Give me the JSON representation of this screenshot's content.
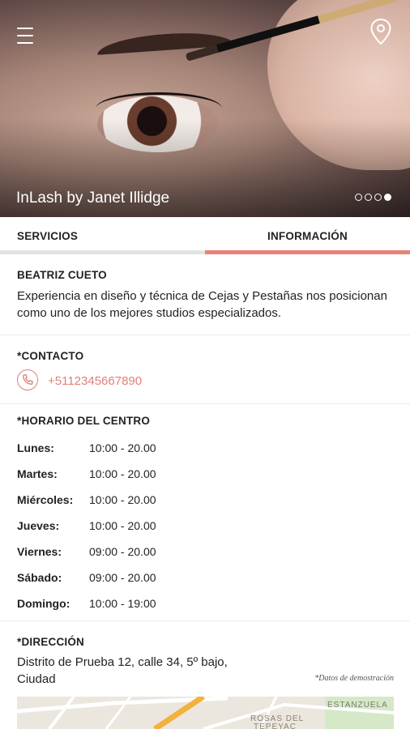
{
  "header": {
    "business_name": "InLash by Janet Illidge",
    "menu_icon": "hamburger-menu-icon",
    "location_icon": "map-pin-icon",
    "carousel_dots": 4,
    "carousel_active_index": 3
  },
  "tabs": [
    {
      "label": "SERVICIOS",
      "active": false
    },
    {
      "label": "INFORMACIÓN",
      "active": true
    }
  ],
  "about": {
    "name": "BEATRIZ CUETO",
    "description": "Experiencia en diseño y técnica de Cejas y Pestañas nos posicionan como uno de los mejores studios especializados."
  },
  "contact": {
    "title": "*CONTACTO",
    "phone_icon": "phone-icon",
    "phone": "+5112345667890"
  },
  "hours": {
    "title": "*HORARIO DEL CENTRO",
    "rows": [
      {
        "day": "Lunes:",
        "time": "10:00 - 20.00"
      },
      {
        "day": "Martes:",
        "time": "10:00 - 20.00"
      },
      {
        "day": "Miércoles:",
        "time": "10:00 - 20.00"
      },
      {
        "day": "Jueves:",
        "time": "10:00 - 20.00"
      },
      {
        "day": "Viernes:",
        "time": "09:00 - 20.00"
      },
      {
        "day": "Sábado:",
        "time": "09:00 - 20.00"
      },
      {
        "day": "Domingo:",
        "time": "10:00 - 19:00"
      }
    ]
  },
  "address": {
    "title": "*DIRECCIÓN",
    "line1": "Distrito de Prueba 12, calle 34, 5º bajo,",
    "line2": "Ciudad",
    "demo_note": "*Datos de demostración"
  },
  "map": {
    "labels": [
      "ROSAS DEL",
      "TEPEYAC",
      "ESTANZUELA"
    ]
  },
  "colors": {
    "accent": "#e8837a",
    "tab_inactive": "#e3e3e3",
    "text": "#222222"
  }
}
